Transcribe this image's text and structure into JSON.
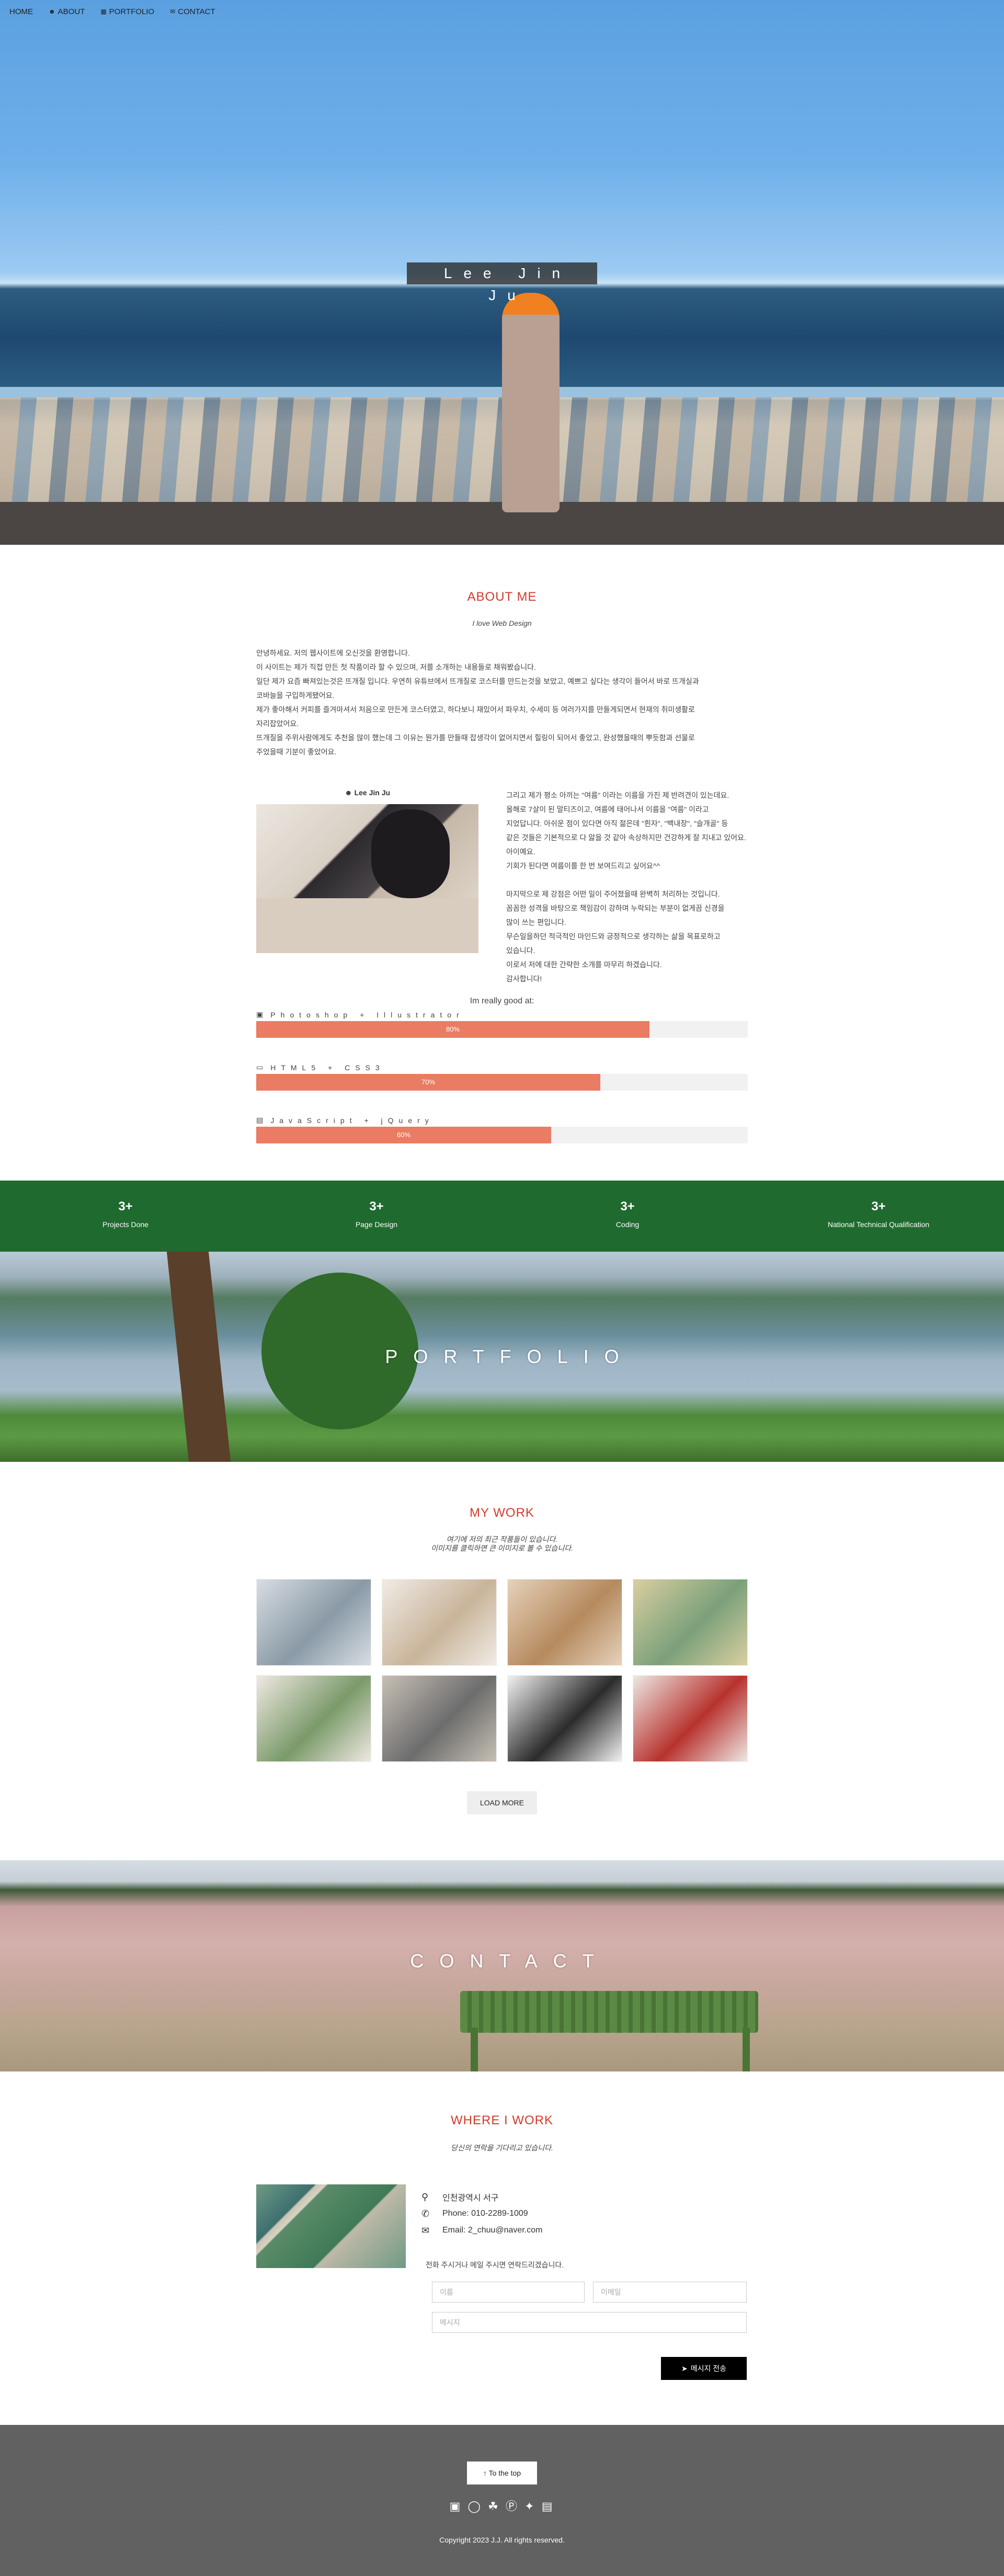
{
  "nav": {
    "items": [
      {
        "label": "HOME",
        "icon": ""
      },
      {
        "label": "ABOUT",
        "icon": "user-icon"
      },
      {
        "label": "PORTFOLIO",
        "icon": "grid-icon"
      },
      {
        "label": "CONTACT",
        "icon": "envelope-icon"
      }
    ]
  },
  "hero": {
    "title": "Lee Jin Ju"
  },
  "about": {
    "title": "ABOUT ME",
    "subtitle": "I love Web Design",
    "intro": [
      "안녕하세요. 저의 웹사이트에 오신것을 환영합니다.",
      "이 사이트는 제가 직접 만든 첫 작품이라 할 수 있으며, 저를 소개하는 내용들로 채워봤습니다.",
      "일단 제가 요즘 빠져있는것은 뜨개질 입니다. 우연히 유튜브에서 뜨개질로 코스터를 만드는것을 보았고, 예쁘고 싶다는 생각이 들어서 바로 뜨개실과",
      "코바늘을 구입하게됐어요.",
      "제가 좋아해서 커피를 즐겨마셔서 처음으로 만든게 코스터였고, 하다보니 재밌어서 파우치, 수세미 등 여러가지를 만들게되면서 현재의 취미생활로",
      "자리잡았어요.",
      "뜨개질을 주위사람에게도 추천을 많이 했는데 그 이유는 뭔가를 만들때 잡생각이 없어지면서 힐링이 되어서 좋았고, 완성했을때의 뿌듯함과 선물로",
      "주었을때 기분이 좋았어요."
    ],
    "profile_name": "Lee Jin Ju",
    "profile_text": [
      "그리고 제가 평소 아끼는 \"여름\" 이라는 이름을 가진 제 반려견이 있는데요.",
      "올해로 7살이 된 말티즈이고, 여름에 태어나서 이름을 \"여름\" 이라고",
      "지었답니다. 아쉬운 점이 있다면 아직 젊은데 \"흰자\", \"백내장\", \"슬개골\" 등",
      "같은 것들은 기본적으로 다 앓을 것 같아 속상하지만 건강하게 잘 지내고 있어요.",
      "아이예요.",
      "기회가 된다면 여름이를 한 번 보여드리고 싶어요^^",
      "",
      "마지막으로 제 강점은 어떤 일이 주어졌을때 완벽히 처리하는 것입니다.",
      "꼼꼼한 성격을 바탕으로 책임감이 강하며 누락되는 부분이 없게끔 신경을",
      "많이 쓰는 편입니다.",
      "무슨일을하던 적극적인 마인드와 긍정적으로 생각하는 삶을 목표로하고",
      "있습니다.",
      "이로서 저에 대한 간략한 소개를 마무리 하겠습니다.",
      "감사합니다!"
    ],
    "skills_heading": "Im really good at:",
    "skills": [
      {
        "label": "Photoshop + Illustrator",
        "value": 80,
        "text": "80%"
      },
      {
        "label": "HTML5 + CSS3",
        "value": 70,
        "text": "70%"
      },
      {
        "label": "JavaScript + jQuery",
        "value": 60,
        "text": "60%"
      }
    ]
  },
  "counters": [
    {
      "num": "3+",
      "label": "Projects Done"
    },
    {
      "num": "3+",
      "label": "Page Design"
    },
    {
      "num": "3+",
      "label": "Coding"
    },
    {
      "num": "3+",
      "label": "National Technical Qualification"
    }
  ],
  "banners": {
    "portfolio": "PORTFOLIO",
    "contact": "CONTACT"
  },
  "portfolio": {
    "title": "MY WORK",
    "sub_line1": "여기에 저의 최근 작품들이 있습니다.",
    "sub_line2": "이미지를 클릭하면 큰 이미지로 볼 수 있습니다.",
    "thumbs": [
      {
        "name": "mountain-clouds",
        "colors": [
          "#8a9aa6",
          "#d8dde2"
        ]
      },
      {
        "name": "coffee-beans",
        "colors": [
          "#c9b49a",
          "#f0ece6"
        ]
      },
      {
        "name": "notebook-sketch",
        "colors": [
          "#b58a5e",
          "#e6d2bb"
        ]
      },
      {
        "name": "map-painting",
        "colors": [
          "#7ba07a",
          "#d9cfa0"
        ]
      },
      {
        "name": "drinks",
        "colors": [
          "#7a9a6a",
          "#efe9e2"
        ]
      },
      {
        "name": "scrunchies",
        "colors": [
          "#6d6d6d",
          "#c7bfb5"
        ]
      },
      {
        "name": "puppy",
        "colors": [
          "#2b2b2b",
          "#f2f2f2"
        ]
      },
      {
        "name": "flower-wreath",
        "colors": [
          "#b8322e",
          "#ede8e4"
        ]
      }
    ],
    "load_more": "LOAD MORE"
  },
  "contact": {
    "title": "WHERE I WORK",
    "subtitle": "당신의 연락을 기다리고 있습니다.",
    "address": "인천광역시 서구",
    "phone": "Phone: 010-2289-1009",
    "email": "Email: 2_chuu@naver.com",
    "note": "전화 주시거나 메일 주시면 연락드리겠습니다.",
    "name_placeholder": "이름",
    "email_placeholder": "이메일",
    "message_placeholder": "메시지",
    "send_label": "메시지 전송"
  },
  "footer": {
    "top_label": "To the top",
    "social": [
      "facebook-icon",
      "instagram-icon",
      "snapchat-icon",
      "pinterest-icon",
      "twitter-icon",
      "linkedin-icon"
    ],
    "copyright": "Copyright 2023 J.J. All rights reserved."
  },
  "colors": {
    "accent_red": "#d33a2c",
    "skill_bar": "#e97c62",
    "counter_bg": "#1f6a2e",
    "footer_bg": "#616161"
  }
}
